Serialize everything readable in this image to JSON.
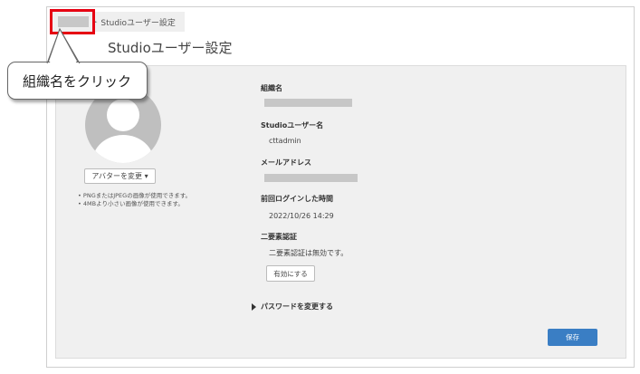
{
  "breadcrumb": {
    "separator": "►",
    "current": "Studioユーザー設定"
  },
  "page_title": "Studioユーザー設定",
  "profile": {
    "avatar_button_label": "アバターを変更 ▾",
    "notes": [
      "PNGまたはJPEGの画像が使用できます。",
      "4MBより小さい画像が使用できます。"
    ]
  },
  "fields": {
    "org_label": "組織名",
    "studio_user_label": "Studioユーザー名",
    "studio_user_value": "cttadmin",
    "email_label": "メールアドレス",
    "last_login_label": "前回ログインした時間",
    "last_login_value": "2022/10/26 14:29",
    "mfa_label": "二要素認証",
    "mfa_status": "二要素認証は無効です。",
    "mfa_enable_button": "有効にする"
  },
  "password_toggle_label": "パスワードを変更する",
  "save_button_label": "保存",
  "annotation": {
    "callout_text": "組織名をクリック",
    "highlight_color": "#e60012"
  },
  "colors": {
    "primary_button": "#3a7ec4",
    "panel_bg": "#f0f0f0"
  }
}
